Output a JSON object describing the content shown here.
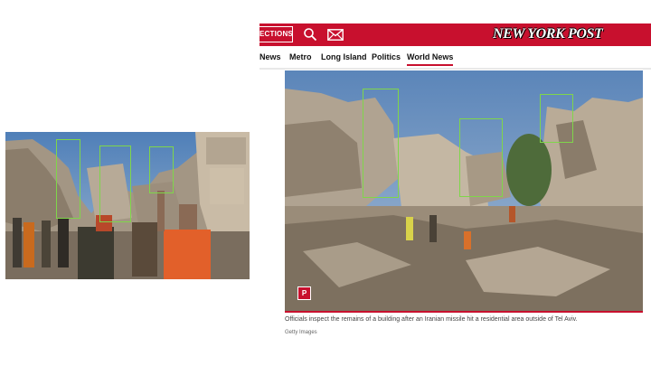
{
  "header": {
    "sections_label": "ECTIONS",
    "brand": "NEW YORK POST",
    "search_icon": "search-icon",
    "mail_icon": "mail-icon",
    "color": "#c8102e"
  },
  "nav": {
    "items": [
      {
        "label": "News"
      },
      {
        "label": "Metro"
      },
      {
        "label": "Long Island"
      },
      {
        "label": "Politics"
      },
      {
        "label": "World News",
        "active": true
      }
    ]
  },
  "article": {
    "badge": "P",
    "caption": "Officials inspect the remains of a building after an Iranian missile hit a residential area outside of Tel Aviv.",
    "credit": "Getty Images"
  },
  "colors": {
    "highlight": "#7fd64a",
    "accent": "#c8102e",
    "sky": "#5b85b9"
  }
}
